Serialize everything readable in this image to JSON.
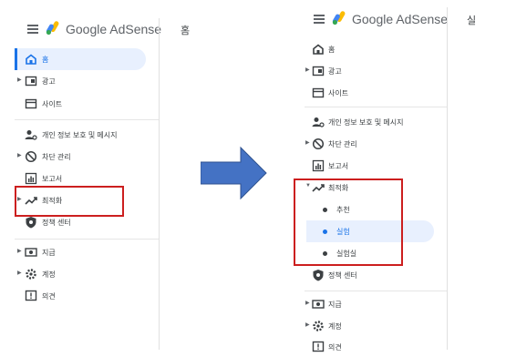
{
  "app": {
    "name": "Google AdSense"
  },
  "left_panel": {
    "page_tab": "홈",
    "nav": [
      {
        "label": "홈",
        "icon": "home-icon"
      },
      {
        "label": "광고",
        "icon": "ad-unit-icon"
      },
      {
        "label": "사이트",
        "icon": "sites-icon"
      },
      {
        "label": "개인 정보 보호 및 메시지",
        "icon": "privacy-messaging-icon"
      },
      {
        "label": "차단 관리",
        "icon": "block-icon"
      },
      {
        "label": "보고서",
        "icon": "reports-icon"
      },
      {
        "label": "최적화",
        "icon": "trending-up-icon"
      },
      {
        "label": "정책 센터",
        "icon": "policy-shield-icon"
      },
      {
        "label": "지급",
        "icon": "payments-icon"
      },
      {
        "label": "계정",
        "icon": "settings-gear-icon"
      },
      {
        "label": "의견",
        "icon": "feedback-icon"
      }
    ]
  },
  "right_panel": {
    "page_tab": "실",
    "nav": [
      {
        "label": "홈",
        "icon": "home-icon"
      },
      {
        "label": "광고",
        "icon": "ad-unit-icon"
      },
      {
        "label": "사이트",
        "icon": "sites-icon"
      },
      {
        "label": "개인 정보 보호 및 메시지",
        "icon": "privacy-messaging-icon"
      },
      {
        "label": "차단 관리",
        "icon": "block-icon"
      },
      {
        "label": "보고서",
        "icon": "reports-icon"
      },
      {
        "label": "최적화",
        "icon": "trending-up-icon"
      },
      {
        "label": "정책 센터",
        "icon": "policy-shield-icon"
      },
      {
        "label": "지급",
        "icon": "payments-icon"
      },
      {
        "label": "계정",
        "icon": "settings-gear-icon"
      },
      {
        "label": "의견",
        "icon": "feedback-icon"
      }
    ],
    "optimization_subitems": [
      {
        "label": "추천"
      },
      {
        "label": "실험"
      },
      {
        "label": "실험실"
      }
    ]
  },
  "colors": {
    "accent": "#1a73e8",
    "highlight_box": "#cc1f1f",
    "arrow": "#4472c4"
  }
}
